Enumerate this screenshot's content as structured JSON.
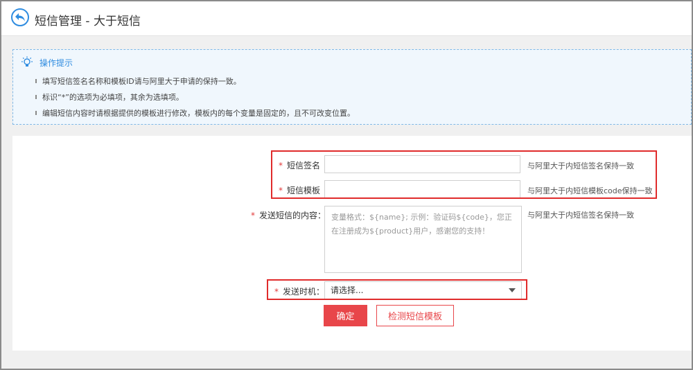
{
  "header": {
    "title": "短信管理 - 大于短信"
  },
  "tips": {
    "title": "操作提示",
    "lines": [
      "填写短信签名名称和模板ID请与阿里大于申请的保持一致。",
      "标识“*”的选项为必填项，其余为选填项。",
      "编辑短信内容时请根据提供的模板进行修改，模板内的每个变量是固定的，且不可改变位置。"
    ]
  },
  "form": {
    "required_mark": "*",
    "signature": {
      "label": "短信签名",
      "value": "",
      "hint": "与阿里大于内短信签名保持一致"
    },
    "template": {
      "label": "短信模板",
      "value": "",
      "hint": "与阿里大于内短信模板code保持一致"
    },
    "content": {
      "label": "发送短信的内容：",
      "placeholder": "变量格式：${name}; 示例：验证码${code}，您正在注册成为${product}用户，感谢您的支持！",
      "hint": "与阿里大于内短信签名保持一致"
    },
    "send_time": {
      "label": "发送时机：",
      "selected": "请选择..."
    },
    "confirm_label": "确定",
    "check_label": "检测短信模板"
  }
}
